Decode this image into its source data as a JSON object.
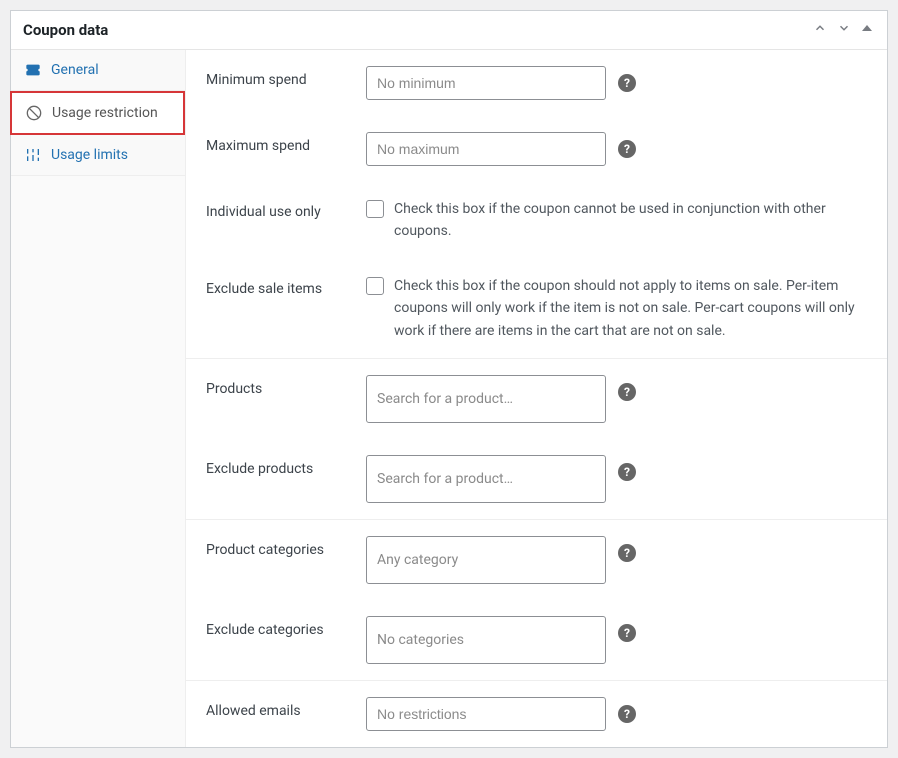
{
  "panel": {
    "title": "Coupon data"
  },
  "sidebar": {
    "items": [
      {
        "label": "General"
      },
      {
        "label": "Usage restriction"
      },
      {
        "label": "Usage limits"
      }
    ]
  },
  "fields": {
    "minimum_spend": {
      "label": "Minimum spend",
      "placeholder": "No minimum"
    },
    "maximum_spend": {
      "label": "Maximum spend",
      "placeholder": "No maximum"
    },
    "individual_use": {
      "label": "Individual use only",
      "description": "Check this box if the coupon cannot be used in conjunction with other coupons."
    },
    "exclude_sale": {
      "label": "Exclude sale items",
      "description": "Check this box if the coupon should not apply to items on sale. Per-item coupons will only work if the item is not on sale. Per-cart coupons will only work if there are items in the cart that are not on sale."
    },
    "products": {
      "label": "Products",
      "placeholder": "Search for a product…"
    },
    "exclude_products": {
      "label": "Exclude products",
      "placeholder": "Search for a product…"
    },
    "product_categories": {
      "label": "Product categories",
      "placeholder": "Any category"
    },
    "exclude_categories": {
      "label": "Exclude categories",
      "placeholder": "No categories"
    },
    "allowed_emails": {
      "label": "Allowed emails",
      "placeholder": "No restrictions"
    }
  }
}
